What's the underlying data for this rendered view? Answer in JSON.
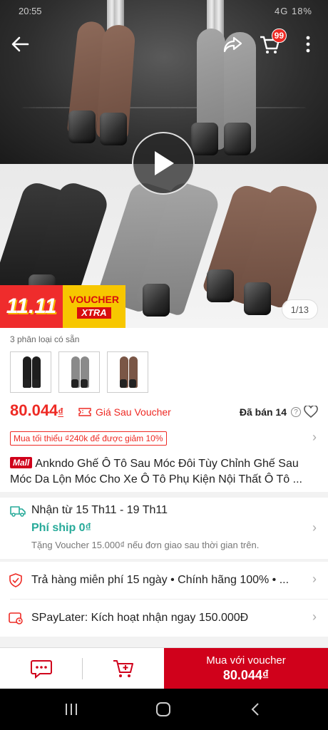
{
  "status_bar": {
    "time": "20:55",
    "right": "4G 18%"
  },
  "header": {
    "back_icon": "arrow-left-icon",
    "share_icon": "share-icon",
    "cart_icon": "cart-icon",
    "cart_count": "99",
    "more_icon": "more-vertical-icon"
  },
  "media": {
    "counter": "1/13",
    "promo_left": "11.11",
    "promo_voucher": "VOUCHER",
    "promo_xtra": "XTRA"
  },
  "variants": {
    "label": "3 phân loại có sẵn",
    "colors": [
      "#1e1e1e",
      "#8a8a8a",
      "#7a5646"
    ]
  },
  "price": {
    "value": "80.044",
    "currency": "₫",
    "voucher_label": "Giá Sau Voucher",
    "sold": "Đã bán 14"
  },
  "min_order": "Mua tối thiểu ₫240k để được giảm 10%",
  "product": {
    "mall_badge": "Mall",
    "title": "Ankndo Ghế Ô Tô Sau Móc Đôi Tùy Chỉnh Ghế Sau Móc Da Lộn Móc Cho Xe Ô Tô Phụ Kiện Nội Thất Ô Tô ..."
  },
  "shipping": {
    "date": "Nhận từ 15 Th11 - 19 Th11",
    "fee": "Phí ship 0₫",
    "note": "Tặng Voucher 15.000₫ nếu đơn giao sau thời gian trên."
  },
  "guarantee": {
    "text": "Trả hàng miễn phí 15 ngày  •  Chính hãng 100%  •  ..."
  },
  "spaylater": {
    "text": "SPayLater: Kích hoạt nhận ngay 150.000Đ"
  },
  "bottom_bar": {
    "chat_icon": "chat-icon",
    "add_cart_icon": "add-to-cart-icon",
    "buy_line1": "Mua với voucher",
    "buy_line2": "80.044₫",
    "accent": "#d0011b"
  }
}
